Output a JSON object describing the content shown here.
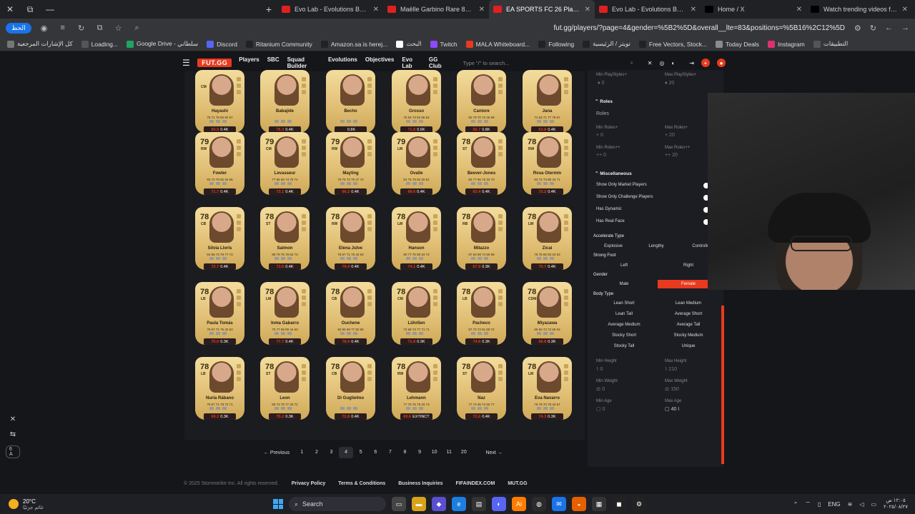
{
  "browser": {
    "tabs": [
      {
        "title": "Evo Lab - Evolutions Builder - F",
        "color": "#e02020",
        "active": false
      },
      {
        "title": "Maëlle Garbino Rare 81 OVR - F",
        "color": "#e02020",
        "active": false
      },
      {
        "title": "EA SPORTS FC 26 Players - FUT.G",
        "color": "#e02020",
        "active": true
      },
      {
        "title": "Evo Lab - Evolutions Builder - F",
        "color": "#e02020",
        "active": false
      },
      {
        "title": "Home / X",
        "color": "#000000",
        "active": false
      },
      {
        "title": "Watch trending videos for you",
        "color": "#000000",
        "active": false
      }
    ],
    "url": "fut.gg/players/?page=4&gender=%5B2%5D&overall__lte=83&positions=%5B16%2C12%5D",
    "translate_label": "الحظ",
    "bookmarks": [
      {
        "label": "كل الإشارات المرجعية"
      },
      {
        "label": "Loading..."
      },
      {
        "label": "Google Drive - سلطاني"
      },
      {
        "label": "Discord"
      },
      {
        "label": "Ritanium Community"
      },
      {
        "label": "Amazon.sa is herej..."
      },
      {
        "label": "البحث"
      },
      {
        "label": "Twitch"
      },
      {
        "label": "MALA Whiteboard..."
      },
      {
        "label": "Following"
      },
      {
        "label": "تويتر / الرئيسية"
      },
      {
        "label": "Free Vectors, Stock..."
      },
      {
        "label": "Today Deals"
      },
      {
        "label": "Instagram"
      },
      {
        "label": "التطبيقات"
      }
    ]
  },
  "site": {
    "logo": "FUT.GG",
    "nav": [
      "Players",
      "SBC",
      "Squad Builder",
      "Evolutions",
      "Objectives",
      "Evo Lab",
      "GG Club"
    ],
    "search_placeholder": "Type \"/\" to search..."
  },
  "cards": [
    {
      "rating": "",
      "pos": "CM",
      "name": "Hayashi",
      "stats": "78 71 78 80 82 67",
      "price": "69.9",
      "extra": "0.4K"
    },
    {
      "rating": "",
      "pos": "",
      "name": "Babajide",
      "stats": "",
      "price": "76.3",
      "extra": "0.4K"
    },
    {
      "rating": "",
      "pos": "",
      "name": "Becho",
      "stats": "",
      "price": "",
      "extra": "0.8K"
    },
    {
      "rating": "",
      "pos": "",
      "name": "Grosso",
      "stats": "76 64 73 82 66 62",
      "price": "71.8",
      "extra": "0.6K"
    },
    {
      "rating": "",
      "pos": "",
      "name": "Cantore",
      "stats": "82 79 70 73 45 68",
      "price": "66.7",
      "extra": "0.8K"
    },
    {
      "rating": "",
      "pos": "",
      "name": "Jana",
      "stats": "71 53 71 77 79 67",
      "price": "63.8",
      "extra": "0.4K"
    },
    {
      "rating": "79",
      "pos": "RW",
      "name": "Fowler",
      "stats": "83 72 70 82 34 65",
      "price": "71.7",
      "extra": "0.4K"
    },
    {
      "rating": "79",
      "pos": "CM",
      "name": "Levasseur",
      "stats": "77 66 65 74 75 74",
      "price": "73.1",
      "extra": "0.4K"
    },
    {
      "rating": "79",
      "pos": "RW",
      "name": "Mayling",
      "stats": "79 75 73 79 47 74",
      "price": "66.2",
      "extra": "0.4K"
    },
    {
      "rating": "79",
      "pos": "LM",
      "name": "Ovalle",
      "stats": "81 75 78 82 30 61",
      "price": "68.6",
      "extra": "0.4K"
    },
    {
      "rating": "78",
      "pos": "ST",
      "name": "Beever-Jones",
      "stats": "82 77 66 75 34 70",
      "price": "63.4",
      "extra": "0.4K"
    },
    {
      "rating": "78",
      "pos": "RW",
      "name": "Rosa Otermín",
      "stats": "83 74 73 80 44 71",
      "price": "72.2",
      "extra": "0.4K"
    },
    {
      "rating": "78",
      "pos": "CB",
      "name": "Silvia Lloris",
      "stats": "64 55 73 79 77 73",
      "price": "72.7",
      "extra": "0.4K"
    },
    {
      "rating": "78",
      "pos": "ST",
      "name": "Salmon",
      "stats": "88 79 75 78 52 73",
      "price": "73.6",
      "extra": "0.4K"
    },
    {
      "rating": "78",
      "pos": "RW",
      "name": "Elena Julve",
      "stats": "78 67 71 76 42 63",
      "price": "79.4",
      "extra": "0.4K"
    },
    {
      "rating": "78",
      "pos": "LM",
      "name": "Hanson",
      "stats": "80 77 70 80 34 73",
      "price": "74.1",
      "extra": "0.4K"
    },
    {
      "rating": "78",
      "pos": "RB",
      "name": "Milazzo",
      "stats": "67 63 69 74 69 68",
      "price": "67.9",
      "extra": "0.3K"
    },
    {
      "rating": "78",
      "pos": "LW",
      "name": "Zicai",
      "stats": "76 76 65 83 34 63",
      "price": "70.7",
      "extra": "0.4K"
    },
    {
      "rating": "78",
      "pos": "LB",
      "name": "Paula Tomás",
      "stats": "78 67 71 76 42 63",
      "price": "75.0",
      "extra": "0.3K"
    },
    {
      "rating": "78",
      "pos": "LM",
      "name": "Inma Gabarro",
      "stats": "70 77 69 80 44 63",
      "price": "77.7",
      "extra": "0.4K"
    },
    {
      "rating": "78",
      "pos": "CB",
      "name": "Ouchene",
      "stats": "82 65 69 77 82 65",
      "price": "78.9",
      "extra": "0.4K"
    },
    {
      "rating": "78",
      "pos": "CM",
      "name": "Lührßen",
      "stats": "72 69 73 77 71 71",
      "price": "71.8",
      "extra": "0.3K"
    },
    {
      "rating": "78",
      "pos": "LB",
      "name": "Pacheco",
      "stats": "87 73 72 81 59 72",
      "price": "74.8",
      "extra": "0.3K"
    },
    {
      "rating": "78",
      "pos": "CDM",
      "name": "Miyazawa",
      "stats": "65 60 73 72 65 62",
      "price": "66.8",
      "extra": "0.3K"
    },
    {
      "rating": "78",
      "pos": "LB",
      "name": "Nuria Rábano",
      "stats": "79 67 71 79 72 71",
      "price": "69.3",
      "extra": "0.3K"
    },
    {
      "rating": "78",
      "pos": "ST",
      "name": "Leon",
      "stats": "80 73 70 77 40 72",
      "price": "70.2",
      "extra": "0.3K"
    },
    {
      "rating": "78",
      "pos": "CB",
      "name": "Di Guglielmo",
      "stats": "",
      "price": "72.8",
      "extra": "0.4K"
    },
    {
      "rating": "78",
      "pos": "RW",
      "name": "Lehmann",
      "stats": "77 75 76 79 33 73",
      "price": "69.6",
      "extra": "EXTINCT"
    },
    {
      "rating": "78",
      "pos": "ST",
      "name": "Naz",
      "stats": "77 74 65 74 50 77",
      "price": "72.6",
      "extra": "0.4K"
    },
    {
      "rating": "78",
      "pos": "LM",
      "name": "Eva Navarro",
      "stats": "78 79 70 78 42 67",
      "price": "74.3",
      "extra": "0.3K"
    }
  ],
  "pagination": {
    "prev": "←  Previous",
    "pages": [
      "1",
      "2",
      "3",
      "4",
      "5",
      "6",
      "7",
      "8",
      "9",
      "10",
      "11",
      "20"
    ],
    "active": "4",
    "next": "Next  →"
  },
  "footer": {
    "copyright": "© 2025 Stormstrike Inc. All rights reserved.",
    "links": [
      "Privacy Policy",
      "Terms & Conditions",
      "Business Inquiries",
      "FIFAINDEX.COM",
      "MUT.GG"
    ]
  },
  "filters": {
    "min_playstyles_label": "Min PlayStyles+",
    "min_playstyles_val": "0",
    "max_playstyles_label": "Max PlayStyles+",
    "max_playstyles_val": "20",
    "roles_section": "Roles",
    "roles_label": "Roles",
    "min_roles_label": "Min Roles+",
    "min_roles_val": "0",
    "max_roles_label": "Max Roles+",
    "max_roles_val": "20",
    "min_roles2_label": "Min Roles++",
    "min_roles2_val": "0",
    "max_roles2_label": "Max Roles++",
    "max_roles2_val": "20",
    "misc_section": "Miscellaneous",
    "toggles": [
      "Show Only Market Players",
      "Show Only Challenge Players",
      "Has Dynamic",
      "Has Real Face"
    ],
    "accel_label": "Accelerate Type",
    "accel": [
      "Explosive",
      "Lengthy",
      "Controlled"
    ],
    "foot_label": "Strong Foot",
    "foot": [
      "Left",
      "Right"
    ],
    "gender_label": "Gender",
    "gender": [
      "Male",
      "Female"
    ],
    "gender_selected": "Female",
    "body_label": "Body Type",
    "body": [
      "Lean Short",
      "Lean Medium",
      "Lean Tall",
      "Average Short",
      "Average Medium",
      "Average Tall",
      "Stocky Short",
      "Stocky Medium",
      "Stocky Tall",
      "Unique"
    ],
    "min_height_label": "Min Height",
    "min_height_val": "0",
    "max_height_label": "Max Height",
    "max_height_val": "210",
    "min_weight_label": "Min Weight",
    "min_weight_val": "0",
    "max_weight_label": "Max Weight",
    "max_weight_val": "150",
    "min_age_label": "Min Age",
    "min_age_val": "0",
    "max_age_label": "Max Age",
    "max_age_val": "40"
  },
  "taskbar": {
    "temp": "20°C",
    "weather_text": "غائم جزئيًا",
    "search": "Search",
    "lang": "ENG",
    "time": "١٢:٠٥ ص",
    "date": "٢٠٢٥/٠٨/٢٧"
  },
  "left_pill": "6 A",
  "colors": {
    "accent": "#e83a1e",
    "card_gold": "#e2c178",
    "bg": "#15161a"
  }
}
